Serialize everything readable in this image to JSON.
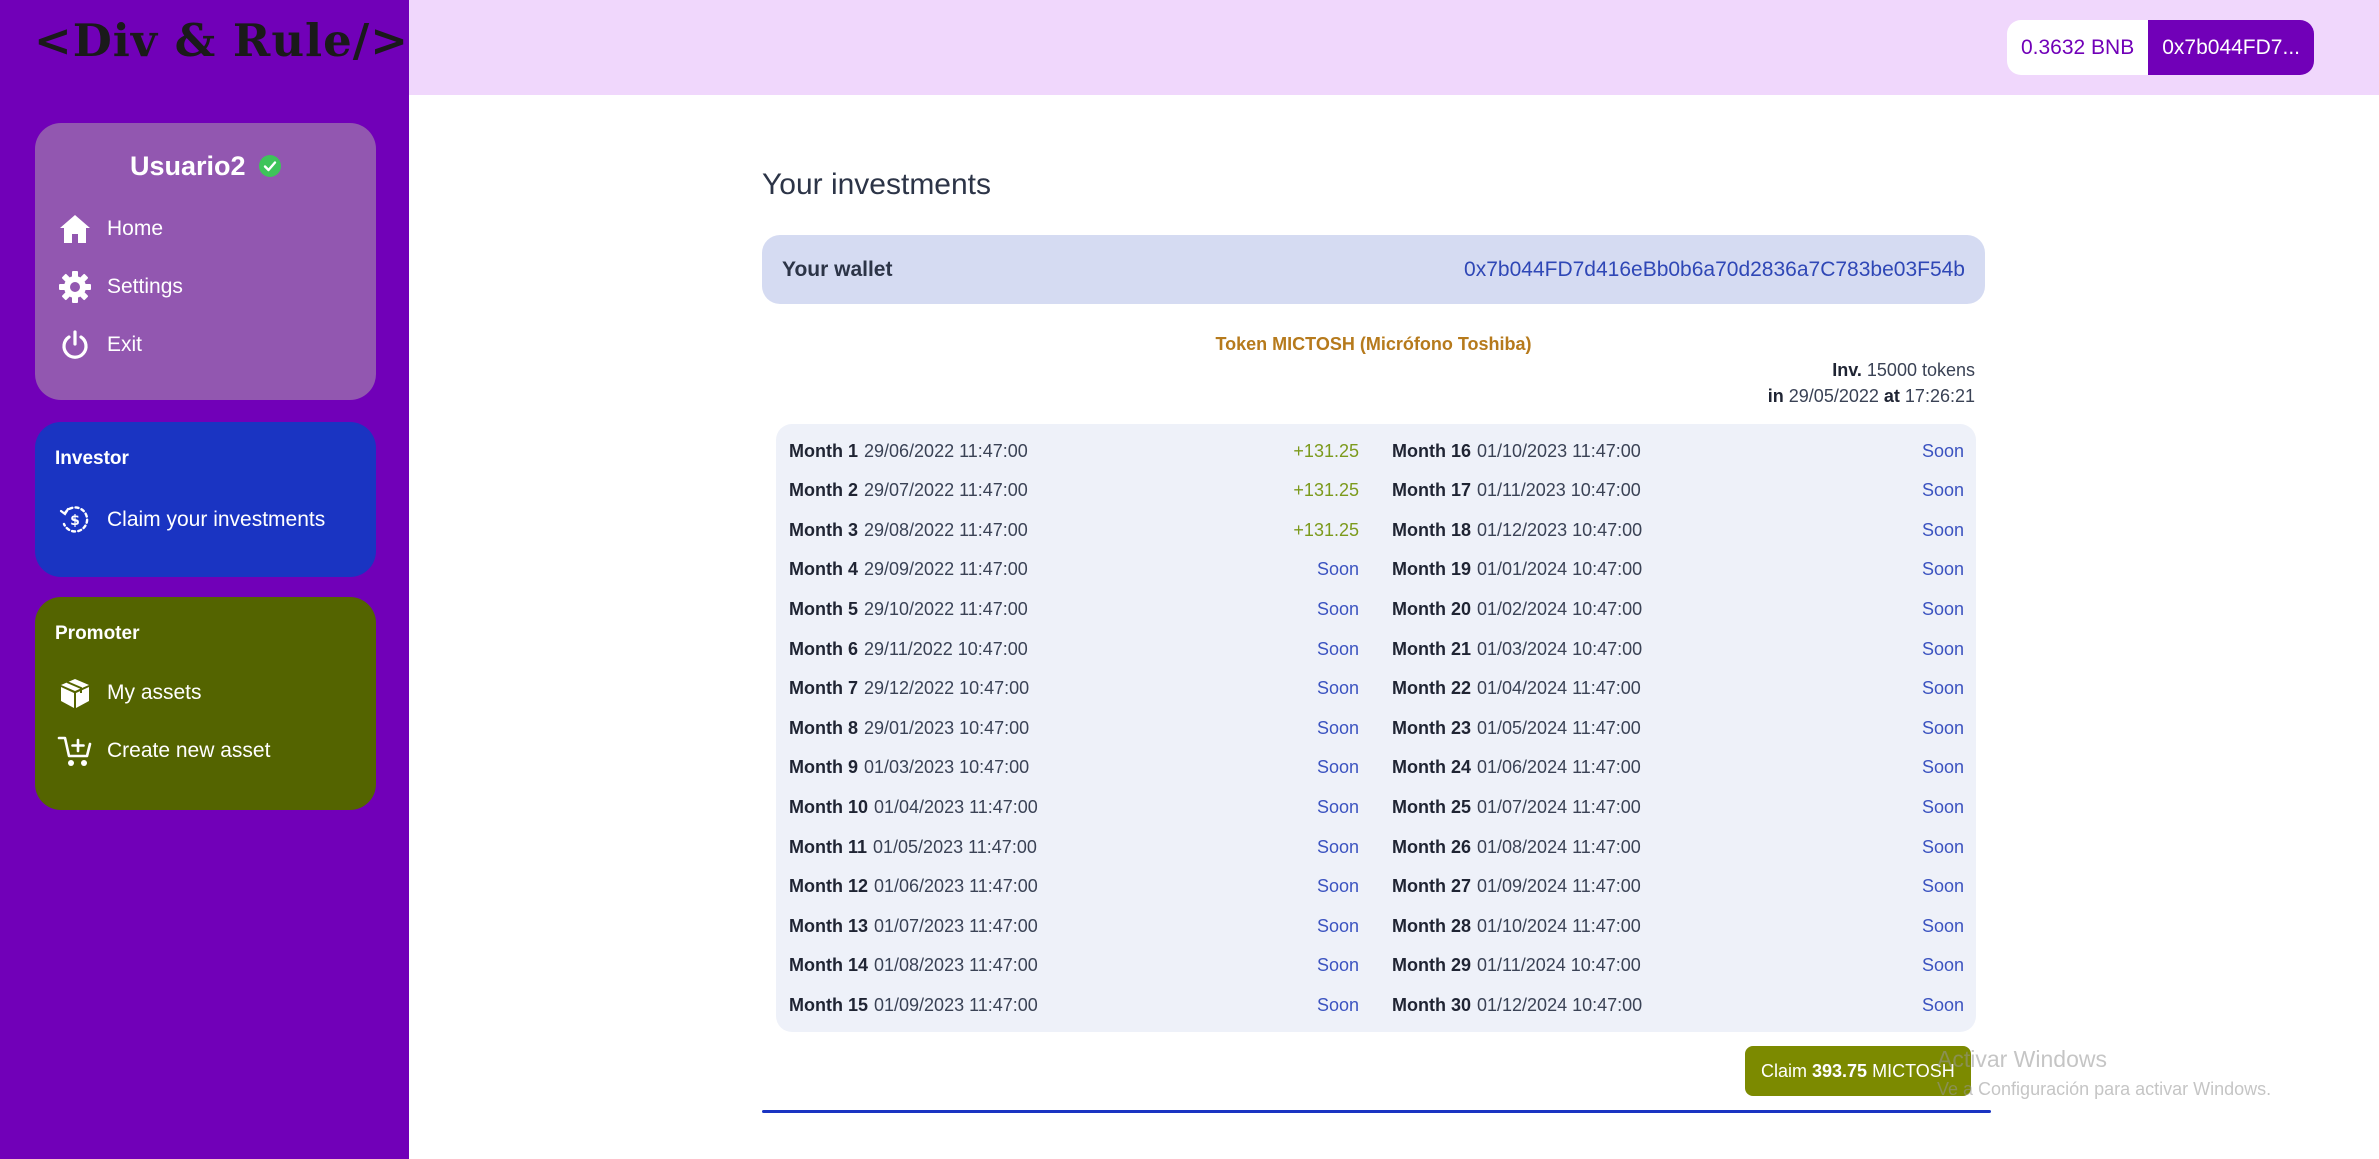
{
  "sidebar": {
    "logo": "<Div & Rule/>",
    "user": {
      "name": "Usuario2",
      "nav": [
        {
          "label": "Home",
          "icon": "home-icon"
        },
        {
          "label": "Settings",
          "icon": "gear-icon"
        },
        {
          "label": "Exit",
          "icon": "power-icon"
        }
      ]
    },
    "investor": {
      "title": "Investor",
      "nav": [
        {
          "label": "Claim your investments",
          "icon": "claim-dollar-icon"
        }
      ]
    },
    "promoter": {
      "title": "Promoter",
      "nav": [
        {
          "label": "My assets",
          "icon": "box-icon"
        },
        {
          "label": "Create new asset",
          "icon": "cart-plus-icon"
        }
      ]
    }
  },
  "topbar": {
    "balance": "0.3632 BNB",
    "address_short": "0x7b044FD7..."
  },
  "main": {
    "title": "Your investments",
    "wallet_label": "Your wallet",
    "wallet_address": "0x7b044FD7d416eBb0b6a70d2836a7C783be03F54b",
    "token_title": "Token MICTOSH (Micrófono Toshiba)",
    "inv_label": "Inv.",
    "inv_value": "15000 tokens",
    "in_label": "in",
    "in_date": "29/05/2022",
    "at_label": "at",
    "at_time": "17:26:21",
    "months_left": [
      {
        "label": "Month 1",
        "date": "29/06/2022 11:47:00",
        "status": "+131.25"
      },
      {
        "label": "Month 2",
        "date": "29/07/2022 11:47:00",
        "status": "+131.25"
      },
      {
        "label": "Month 3",
        "date": "29/08/2022 11:47:00",
        "status": "+131.25"
      },
      {
        "label": "Month 4",
        "date": "29/09/2022 11:47:00",
        "status": "Soon"
      },
      {
        "label": "Month 5",
        "date": "29/10/2022 11:47:00",
        "status": "Soon"
      },
      {
        "label": "Month 6",
        "date": "29/11/2022 10:47:00",
        "status": "Soon"
      },
      {
        "label": "Month 7",
        "date": "29/12/2022 10:47:00",
        "status": "Soon"
      },
      {
        "label": "Month 8",
        "date": "29/01/2023 10:47:00",
        "status": "Soon"
      },
      {
        "label": "Month 9",
        "date": "01/03/2023 10:47:00",
        "status": "Soon"
      },
      {
        "label": "Month 10",
        "date": "01/04/2023 11:47:00",
        "status": "Soon"
      },
      {
        "label": "Month 11",
        "date": "01/05/2023 11:47:00",
        "status": "Soon"
      },
      {
        "label": "Month 12",
        "date": "01/06/2023 11:47:00",
        "status": "Soon"
      },
      {
        "label": "Month 13",
        "date": "01/07/2023 11:47:00",
        "status": "Soon"
      },
      {
        "label": "Month 14",
        "date": "01/08/2023 11:47:00",
        "status": "Soon"
      },
      {
        "label": "Month 15",
        "date": "01/09/2023 11:47:00",
        "status": "Soon"
      }
    ],
    "months_right": [
      {
        "label": "Month 16",
        "date": "01/10/2023 11:47:00",
        "status": "Soon"
      },
      {
        "label": "Month 17",
        "date": "01/11/2023 10:47:00",
        "status": "Soon"
      },
      {
        "label": "Month 18",
        "date": "01/12/2023 10:47:00",
        "status": "Soon"
      },
      {
        "label": "Month 19",
        "date": "01/01/2024 10:47:00",
        "status": "Soon"
      },
      {
        "label": "Month 20",
        "date": "01/02/2024 10:47:00",
        "status": "Soon"
      },
      {
        "label": "Month 21",
        "date": "01/03/2024 10:47:00",
        "status": "Soon"
      },
      {
        "label": "Month 22",
        "date": "01/04/2024 11:47:00",
        "status": "Soon"
      },
      {
        "label": "Month 23",
        "date": "01/05/2024 11:47:00",
        "status": "Soon"
      },
      {
        "label": "Month 24",
        "date": "01/06/2024 11:47:00",
        "status": "Soon"
      },
      {
        "label": "Month 25",
        "date": "01/07/2024 11:47:00",
        "status": "Soon"
      },
      {
        "label": "Month 26",
        "date": "01/08/2024 11:47:00",
        "status": "Soon"
      },
      {
        "label": "Month 27",
        "date": "01/09/2024 11:47:00",
        "status": "Soon"
      },
      {
        "label": "Month 28",
        "date": "01/10/2024 11:47:00",
        "status": "Soon"
      },
      {
        "label": "Month 29",
        "date": "01/11/2024 10:47:00",
        "status": "Soon"
      },
      {
        "label": "Month 30",
        "date": "01/12/2024 10:47:00",
        "status": "Soon"
      }
    ],
    "claim": {
      "prefix": "Claim",
      "amount": "393.75",
      "suffix": "MICTOSH"
    }
  },
  "watermark": {
    "line1": "Activar Windows",
    "line2": "Ve a Configuración para activar Windows."
  },
  "colors": {
    "sidebar": "#7100b8",
    "user_card": "#9257b0",
    "investor_card": "#1a34c2",
    "promoter_card": "#546400",
    "topbar": "#f0d7fc",
    "paid": "#7c9a1c",
    "soon": "#3b53c0",
    "claim_button": "#7c8a00"
  }
}
